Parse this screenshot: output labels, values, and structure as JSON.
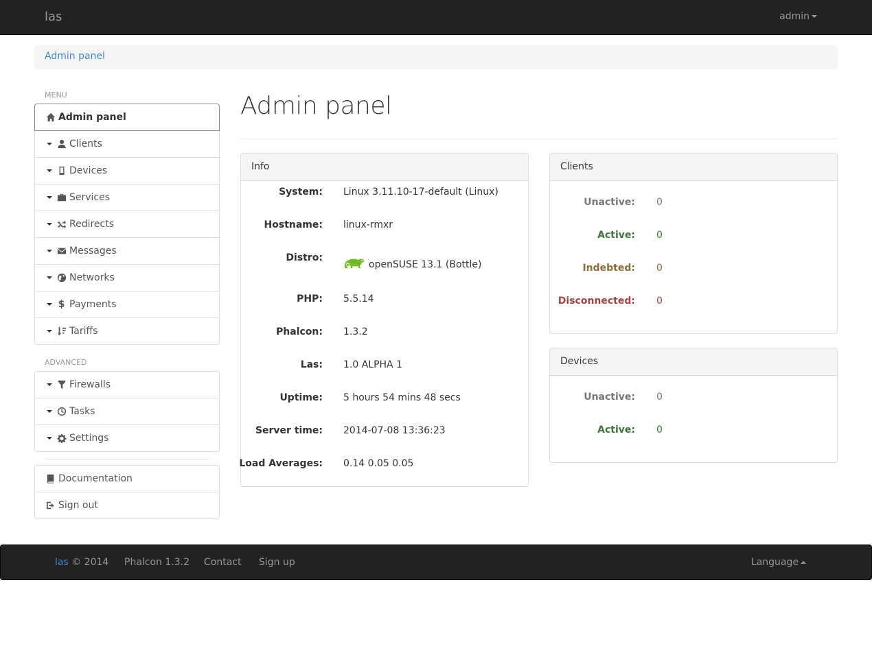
{
  "navbar": {
    "brand": "las",
    "user": "admin"
  },
  "breadcrumb": {
    "item": "Admin panel"
  },
  "sidebar": {
    "menu_header": "MENU",
    "items": [
      {
        "label": "Admin panel",
        "icon": "home-icon",
        "active": true,
        "caret": false
      },
      {
        "label": "Clients",
        "icon": "user-icon",
        "caret": true
      },
      {
        "label": "Devices",
        "icon": "phone-icon",
        "caret": true
      },
      {
        "label": "Services",
        "icon": "briefcase-icon",
        "caret": true
      },
      {
        "label": "Redirects",
        "icon": "random-icon",
        "caret": true
      },
      {
        "label": "Messages",
        "icon": "envelope-icon",
        "caret": true
      },
      {
        "label": "Networks",
        "icon": "globe-icon",
        "caret": true
      },
      {
        "label": "Payments",
        "icon": "dollar-icon",
        "caret": true
      },
      {
        "label": "Tariffs",
        "icon": "sort-icon",
        "caret": true
      }
    ],
    "advanced_header": "ADVANCED",
    "advanced_items": [
      {
        "label": "Firewalls",
        "icon": "filter-icon",
        "caret": true
      },
      {
        "label": "Tasks",
        "icon": "clock-icon",
        "caret": true
      },
      {
        "label": "Settings",
        "icon": "cog-icon",
        "caret": true
      }
    ],
    "extra_items": [
      {
        "label": "Documentation",
        "icon": "book-icon"
      },
      {
        "label": "Sign out",
        "icon": "log-out-icon"
      }
    ]
  },
  "main": {
    "title": "Admin panel",
    "info": {
      "heading": "Info",
      "rows": [
        {
          "key": "System:",
          "value": "Linux 3.11.10-17-default (Linux)"
        },
        {
          "key": "Hostname:",
          "value": "linux-rmxr"
        },
        {
          "key": "Distro:",
          "value": "openSUSE 13.1 (Bottle)",
          "icon": "opensuse-logo-icon"
        },
        {
          "key": "PHP:",
          "value": "5.5.14"
        },
        {
          "key": "Phalcon:",
          "value": "1.3.2"
        },
        {
          "key": "Las:",
          "value": "1.0 ALPHA 1"
        },
        {
          "key": "Uptime:",
          "value": "5 hours 54 mins 48 secs"
        },
        {
          "key": "Server time:",
          "value": "2014-07-08 13:36:23"
        },
        {
          "key": "Load Averages:",
          "value": "0.14 0.05 0.05"
        }
      ]
    },
    "clients": {
      "heading": "Clients",
      "rows": [
        {
          "key": "Unactive:",
          "value": "0",
          "status": "muted"
        },
        {
          "key": "Active:",
          "value": "0",
          "status": "success"
        },
        {
          "key": "Indebted:",
          "value": "0",
          "status": "warning"
        },
        {
          "key": "Disconnected:",
          "value": "0",
          "status": "danger"
        }
      ]
    },
    "devices": {
      "heading": "Devices",
      "rows": [
        {
          "key": "Unactive:",
          "value": "0",
          "status": "muted"
        },
        {
          "key": "Active:",
          "value": "0",
          "status": "success"
        }
      ]
    }
  },
  "footer": {
    "brand_link": "las",
    "copyright": "© 2014",
    "phalcon": "Phalcon 1.3.2",
    "contact": "Contact",
    "signup": "Sign up",
    "language": "Language"
  },
  "colors": {
    "navbar_bg": "#222222",
    "link": "#428bca",
    "muted": "#777777",
    "success": "#3c763d",
    "warning": "#8a6d3b",
    "danger": "#a94442",
    "opensuse_green": "#73ba25"
  }
}
